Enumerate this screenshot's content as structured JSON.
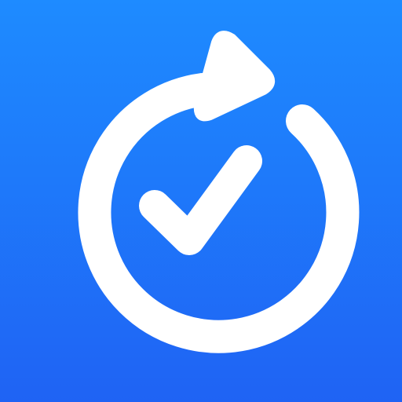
{
  "icon": {
    "background_top": "#1E8BFF",
    "background_bottom": "#1F63F4",
    "foreground": "#FFFFFF",
    "glyphs": [
      "refresh-arrow-icon",
      "checkmark-icon"
    ]
  }
}
